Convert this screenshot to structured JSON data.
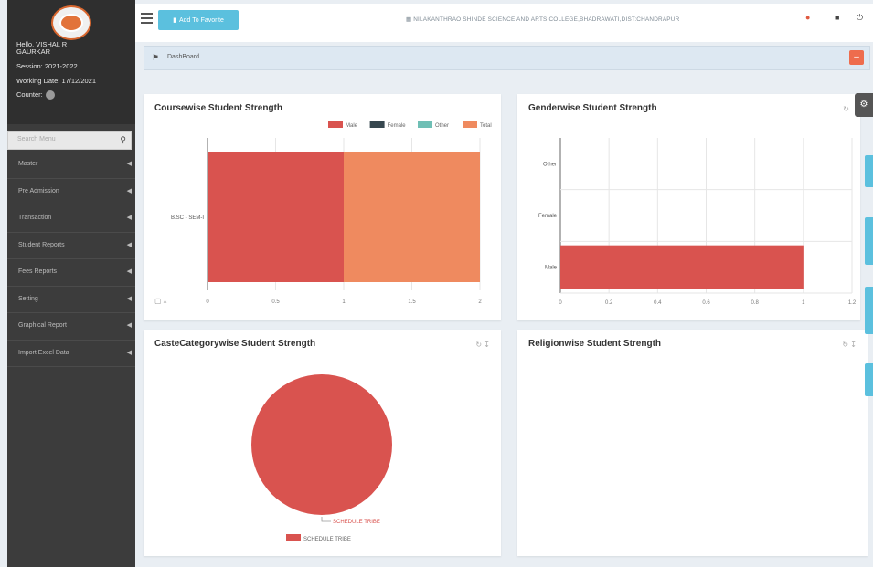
{
  "sidebar": {
    "greeting": "Hello, VISHAL R",
    "greeting2": "GAURKAR",
    "session": "Session: 2021-2022",
    "working_date": "Working Date: 17/12/2021",
    "counter_label": "Counter:",
    "search_placeholder": "Search Menu",
    "menu": [
      {
        "label": "Master"
      },
      {
        "label": "Pre Admission"
      },
      {
        "label": "Transaction"
      },
      {
        "label": "Student Reports"
      },
      {
        "label": "Fees Reports"
      },
      {
        "label": "Setting"
      },
      {
        "label": "Graphical Report"
      },
      {
        "label": "Import Excel Data"
      }
    ]
  },
  "topbar": {
    "add_favorite": "Add To Favorite",
    "college": "NILAKANTHRAO SHINDE SCIENCE AND ARTS COLLEGE,BHADRAWATI,DIST:CHANDRAPUR"
  },
  "breadcrumb": {
    "label": "DashBoard"
  },
  "cards": {
    "course": {
      "title": "Coursewise Student Strength"
    },
    "gender": {
      "title": "Genderwise Student Strength"
    },
    "caste": {
      "title": "CasteCategorywise Student Strength"
    },
    "religion": {
      "title": "Religionwise Student Strength"
    }
  },
  "colors": {
    "male": "#d9534f",
    "female": "#37474f",
    "other": "#6fbfb5",
    "total": "#ef8a5f",
    "accent": "#5bc0de"
  },
  "chart_data": [
    {
      "type": "bar",
      "title": "Coursewise Student Strength",
      "orientation": "horizontal",
      "categories": [
        "B.SC - SEM-I"
      ],
      "series": [
        {
          "name": "Male",
          "values": [
            1
          ]
        },
        {
          "name": "Female",
          "values": [
            0
          ]
        },
        {
          "name": "Other",
          "values": [
            0
          ]
        },
        {
          "name": "Total",
          "values": [
            1
          ]
        }
      ],
      "xlim": [
        0,
        2
      ],
      "xticks": [
        "0",
        "0.5",
        "1",
        "1.5",
        "2"
      ],
      "legend": "top-right"
    },
    {
      "type": "bar",
      "title": "Genderwise Student Strength",
      "orientation": "horizontal",
      "categories": [
        "Other",
        "Female",
        "Male"
      ],
      "values": [
        0,
        0,
        1
      ],
      "xlim": [
        0,
        1.2
      ],
      "xticks": [
        "0",
        "0.2",
        "0.4",
        "0.6",
        "0.8",
        "1",
        "1.2"
      ]
    },
    {
      "type": "pie",
      "title": "CasteCategorywise Student Strength",
      "slices": [
        {
          "label": "SCHEDULE TRIBE",
          "value": 1
        }
      ],
      "legend": "bottom"
    }
  ]
}
